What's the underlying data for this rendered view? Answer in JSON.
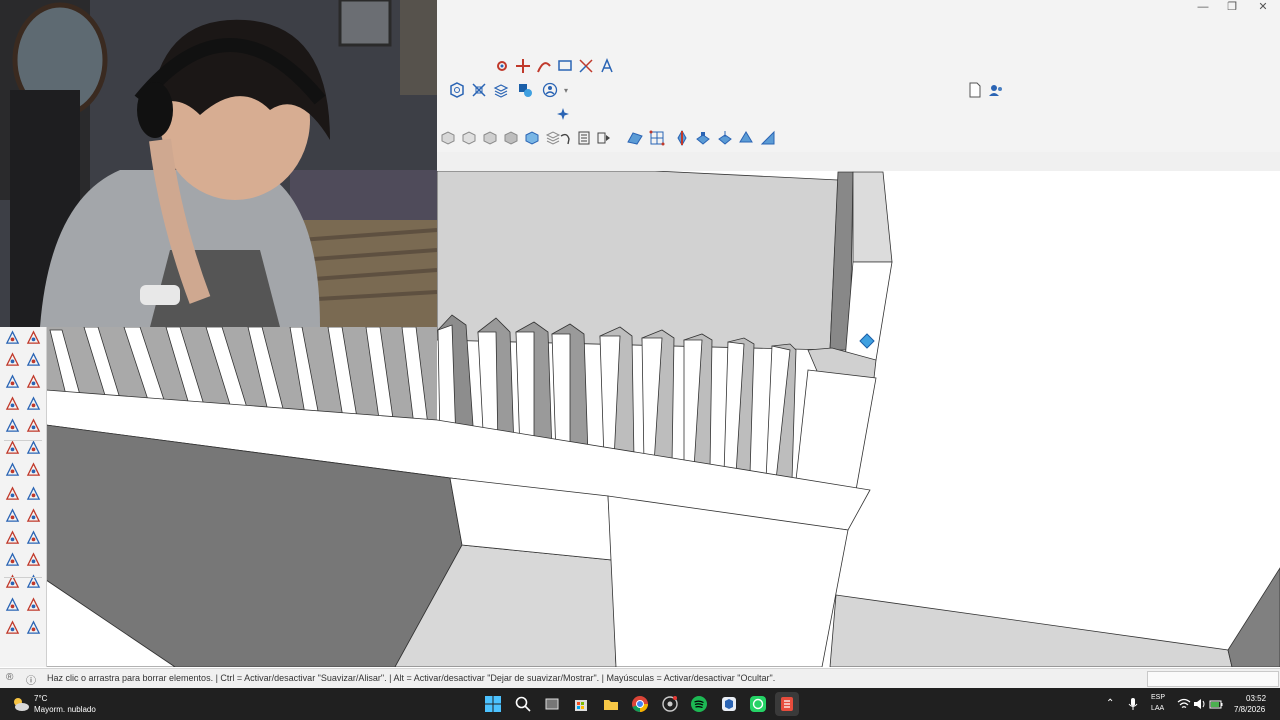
{
  "window": {
    "minimize_label": "—",
    "maximize_label": "❐",
    "close_label": "✕"
  },
  "toolbar": {
    "row1_icons": [
      "orbit-icon",
      "move-icon",
      "arc-icon",
      "dimension-icon",
      "axes-icon",
      "text-icon"
    ],
    "row2_icons": [
      "section-icon",
      "position-camera-icon",
      "layers-icon",
      "styles-icon",
      "account-icon"
    ],
    "row3_icons": [
      "advanced-tool-icon"
    ],
    "row4_icons": [
      "xray-icon",
      "wireframe-icon",
      "hidden-line-icon",
      "shaded-icon",
      "textured-icon",
      "monochrome-icon",
      "undo-icon",
      "model-info-icon",
      "next-scene-icon",
      "sandbox-icon",
      "grid-icon",
      "push-icon",
      "stamp-icon",
      "drape-icon",
      "add-detail-icon",
      "flip-icon"
    ],
    "right_icons": [
      "new-file-icon",
      "user-icon"
    ]
  },
  "palette": {
    "icons": [
      "orbit-icon",
      "pencil-icon",
      "move-icon",
      "push-pull-icon",
      "rotate-icon",
      "follow-me-icon",
      "scale-icon",
      "offset-icon",
      "axes-icon",
      "protractor-icon",
      "position-icon",
      "dimension-icon",
      "tape-icon",
      "text-icon",
      "section-plane-icon",
      "walk-icon",
      "zoom-icon",
      "zoom-extents-icon",
      "zoom-window-icon",
      "previous-icon",
      "look-around-icon",
      "walk-person-icon",
      "eye-icon",
      "pan-icon",
      "components-icon",
      "layers-icon",
      "styles-icon",
      "materials-icon"
    ]
  },
  "status": {
    "hint": "Haz clic o arrastra para borrar elementos. | Ctrl = Activar/desactivar \"Suavizar/Alisar\". | Alt = Activar/desactivar \"Dejar de suavizar/Mostrar\". | Mayúsculas = Activar/desactivar \"Ocultar\".",
    "measurements_value": ""
  },
  "taskbar": {
    "weather_temp": "7°C",
    "weather_desc": "Mayorm. nublado",
    "apps": [
      "start-icon",
      "search-icon",
      "task-view-icon",
      "store-icon",
      "file-explorer-icon",
      "chrome-icon",
      "obs-icon",
      "spotify-icon",
      "sketchup-icon",
      "whatsapp-icon",
      "layout-icon"
    ],
    "lang_line1": "ESP",
    "lang_line2": "LAA",
    "time": "03:52",
    "date": "7/8/2026"
  },
  "colors": {
    "accent": "#2a64b4",
    "taskbar_bg": "#202020",
    "toolbar_bg": "#f3f3f3"
  }
}
